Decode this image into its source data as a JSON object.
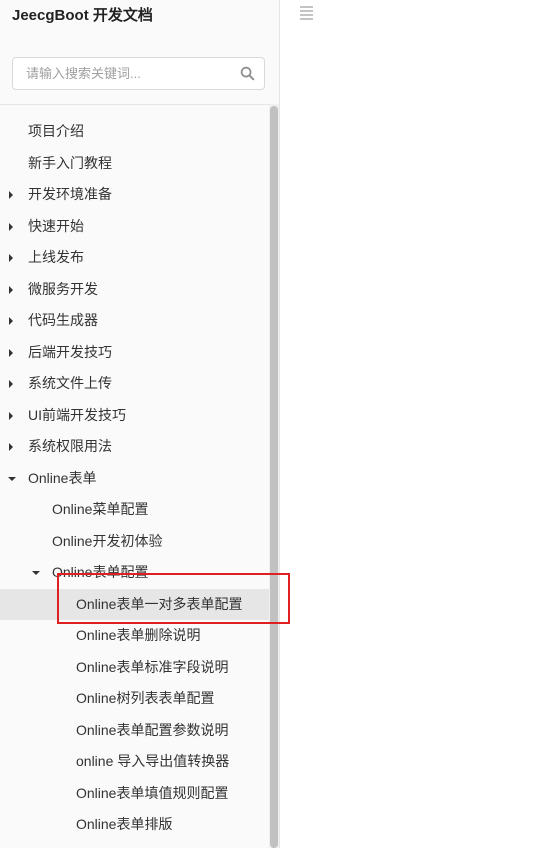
{
  "brand": {
    "title": "JeecgBoot 开发文档"
  },
  "search": {
    "placeholder": "请输入搜索关键词..."
  },
  "icons": {
    "search": "search-icon",
    "menu": "hamburger-menu-icon",
    "expand": "caret-right-icon",
    "collapse": "caret-down-icon"
  },
  "colors": {
    "highlight_border": "#e02020",
    "active_background": "#e6e6e6"
  },
  "nav": {
    "items": [
      {
        "label": "项目介绍"
      },
      {
        "label": "新手入门教程"
      },
      {
        "label": "开发环境准备"
      },
      {
        "label": "快速开始"
      },
      {
        "label": "上线发布"
      },
      {
        "label": "微服务开发"
      },
      {
        "label": "代码生成器"
      },
      {
        "label": "后端开发技巧"
      },
      {
        "label": "系统文件上传"
      },
      {
        "label": "UI前端开发技巧"
      },
      {
        "label": "系统权限用法"
      },
      {
        "label": "Online表单"
      },
      {
        "label": "Online菜单配置"
      },
      {
        "label": "Online开发初体验"
      },
      {
        "label": "Online表单配置"
      },
      {
        "label": "Online表单一对多表单配置"
      },
      {
        "label": "Online表单删除说明"
      },
      {
        "label": "Online表单标准字段说明"
      },
      {
        "label": "Online树列表表单配置"
      },
      {
        "label": "Online表单配置参数说明"
      },
      {
        "label": "online 导入导出值转换器"
      },
      {
        "label": "Online表单填值规则配置"
      },
      {
        "label": "Online表单排版"
      }
    ]
  }
}
